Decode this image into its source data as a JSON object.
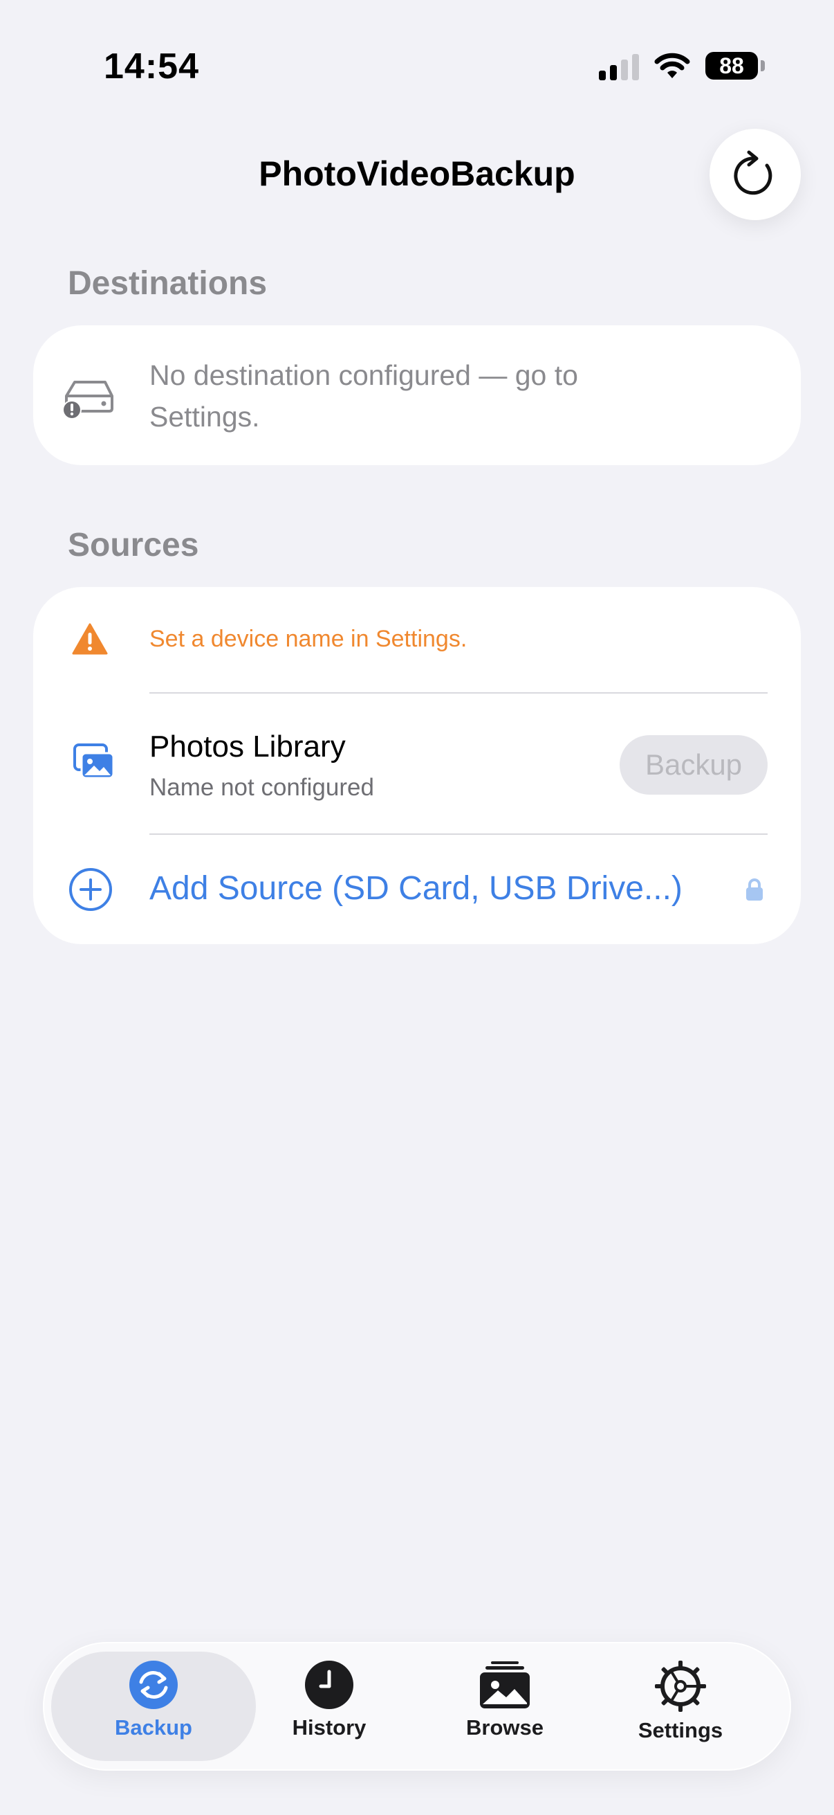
{
  "status_bar": {
    "time": "14:54",
    "battery": "88",
    "icons": [
      "cellular-signal-icon",
      "wifi-icon",
      "battery-icon"
    ]
  },
  "nav": {
    "title": "PhotoVideoBackup",
    "refresh_icon": "refresh-icon"
  },
  "destinations": {
    "header": "Destinations",
    "empty_message": "No destination configured — go to Settings.",
    "icon": "drive-warning-icon"
  },
  "sources": {
    "header": "Sources",
    "warning": {
      "text": "Set a device name in Settings.",
      "icon": "warning-triangle-icon",
      "color": "#f0882f"
    },
    "photos_library": {
      "title": "Photos Library",
      "subtitle": "Name not configured",
      "button_label": "Backup",
      "icon": "photos-icon"
    },
    "add_source": {
      "label": "Add Source (SD Card, USB Drive...)",
      "icon": "plus-circle-icon",
      "lock_icon": "lock-icon",
      "color": "#3e80e5"
    }
  },
  "tab_bar": {
    "tabs": [
      {
        "label": "Backup",
        "icon": "backup-sync-icon",
        "active": true
      },
      {
        "label": "History",
        "icon": "clock-icon",
        "active": false
      },
      {
        "label": "Browse",
        "icon": "photo-stack-icon",
        "active": false
      },
      {
        "label": "Settings",
        "icon": "gear-icon",
        "active": false
      }
    ],
    "accent": "#3e80e5"
  }
}
